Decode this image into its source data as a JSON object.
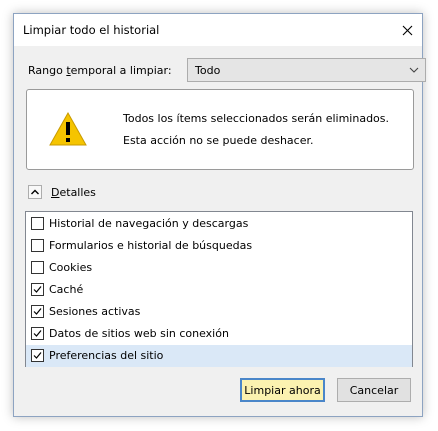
{
  "window": {
    "title": "Limpiar todo el historial",
    "close_icon": "close-icon"
  },
  "range": {
    "label_before": "Rango ",
    "label_accel": "t",
    "label_after": "emporal a limpiar:",
    "selected": "Todo"
  },
  "warning": {
    "icon": "warning-triangle-icon",
    "line1": "Todos los ítems seleccionados serán eliminados.",
    "line2": "Esta acción no se puede deshacer."
  },
  "details": {
    "label_accel": "D",
    "label_rest": "etalles",
    "expanded": true
  },
  "items": [
    {
      "label": "Historial de navegación y descargas",
      "checked": false
    },
    {
      "label": "Formularios e historial de búsquedas",
      "checked": false
    },
    {
      "label": "Cookies",
      "checked": false
    },
    {
      "label": "Caché",
      "checked": true
    },
    {
      "label": "Sesiones activas",
      "checked": true
    },
    {
      "label": "Datos de sitios web sin conexión",
      "checked": true
    },
    {
      "label": "Preferencias del sitio",
      "checked": true
    }
  ],
  "buttons": {
    "clear": "Limpiar ahora",
    "cancel": "Cancelar"
  },
  "colors": {
    "primary_button_bg": "#fbf2b0",
    "primary_button_border": "#4a86c9",
    "selected_row": "#dae8f7",
    "warning_yellow": "#f5c400"
  }
}
